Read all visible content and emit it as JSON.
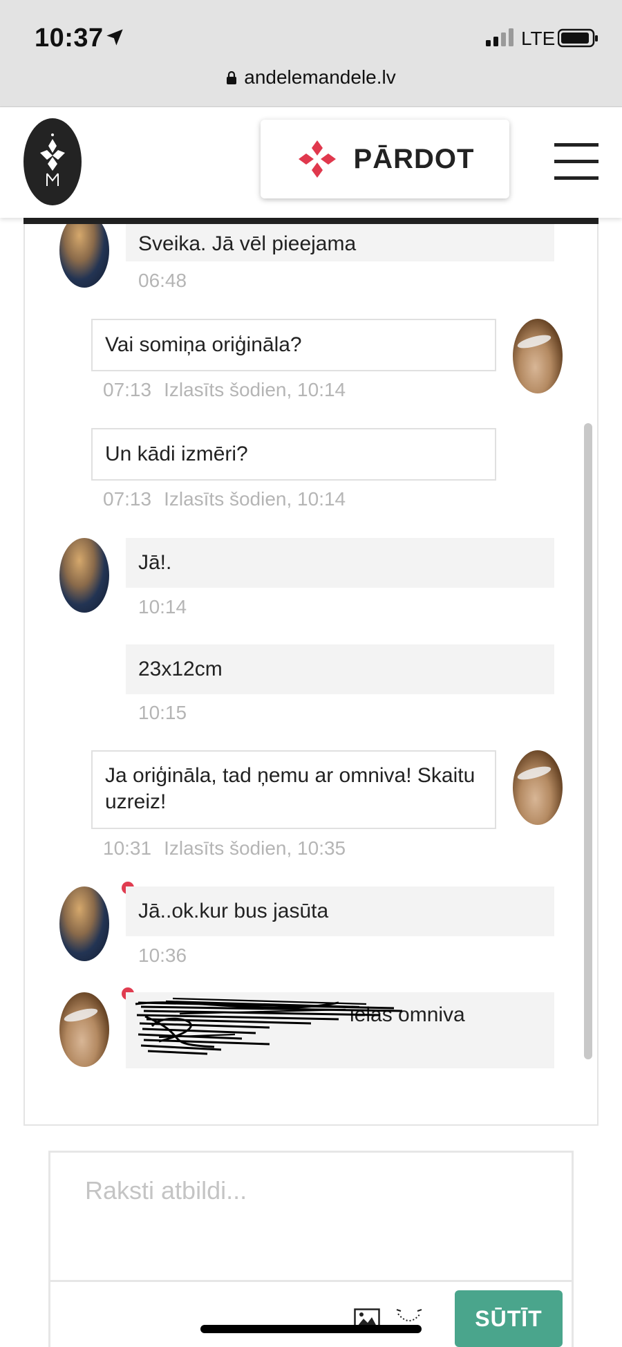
{
  "status_bar": {
    "time": "10:37",
    "network": "LTE",
    "url": "andelemandele.lv"
  },
  "header": {
    "sell_label": "PĀRDOT",
    "accent_color": "#e0384d"
  },
  "messages": [
    {
      "side": "in",
      "text": "Sveika. Jā vēl pieejama",
      "time": "06:48",
      "read": ""
    },
    {
      "side": "out",
      "text": "Vai somiņa oriģināla?",
      "time": "07:13",
      "read": "Izlasīts šodien, 10:14"
    },
    {
      "side": "out",
      "text": "Un kādi izmēri?",
      "time": "07:13",
      "read": "Izlasīts šodien, 10:14"
    },
    {
      "side": "in",
      "text": "Jā!.",
      "time": "10:14",
      "read": ""
    },
    {
      "side": "in",
      "text": "23x12cm",
      "time": "10:15",
      "read": ""
    },
    {
      "side": "out",
      "text": "Ja oriģināla, tad ņemu ar omniva! Skaitu uzreiz!",
      "time": "10:31",
      "read": "Izlasīts šodien, 10:35"
    },
    {
      "side": "in",
      "text": "Jā..ok.kur bus jasūta",
      "time": "10:36",
      "read": ""
    },
    {
      "side": "out-redacted",
      "text": "ielas omniva",
      "time": "",
      "read": ""
    }
  ],
  "reply": {
    "placeholder": "Raksti atbildi...",
    "send_label": "SŪTĪT"
  },
  "colors": {
    "send_button": "#4aa58c",
    "unread_dot": "#e03c50"
  }
}
